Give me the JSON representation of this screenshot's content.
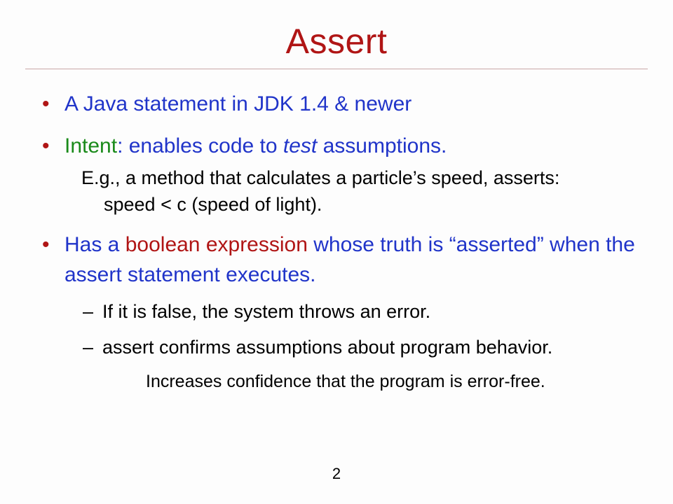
{
  "title": "Assert",
  "bullets": {
    "b1": "A Java statement in JDK 1.4 & newer",
    "b2": {
      "intent": "Intent",
      "rest": ": enables code to ",
      "test": "test",
      "rest2": " assumptions.",
      "sub_line1": "E.g., a method that calculates a particle’s speed, asserts:",
      "sub_line2": "speed < c (speed of light)."
    },
    "b3": {
      "pre": "Has a ",
      "boolexp": "boolean expression",
      "post": " whose truth is “asserted” when the assert statement executes.",
      "d1": "If it is false, the system throws an error.",
      "d2": "assert confirms assumptions about program behavior.",
      "d2sub": "Increases confidence that the program is error-free."
    }
  },
  "page_number": "2"
}
